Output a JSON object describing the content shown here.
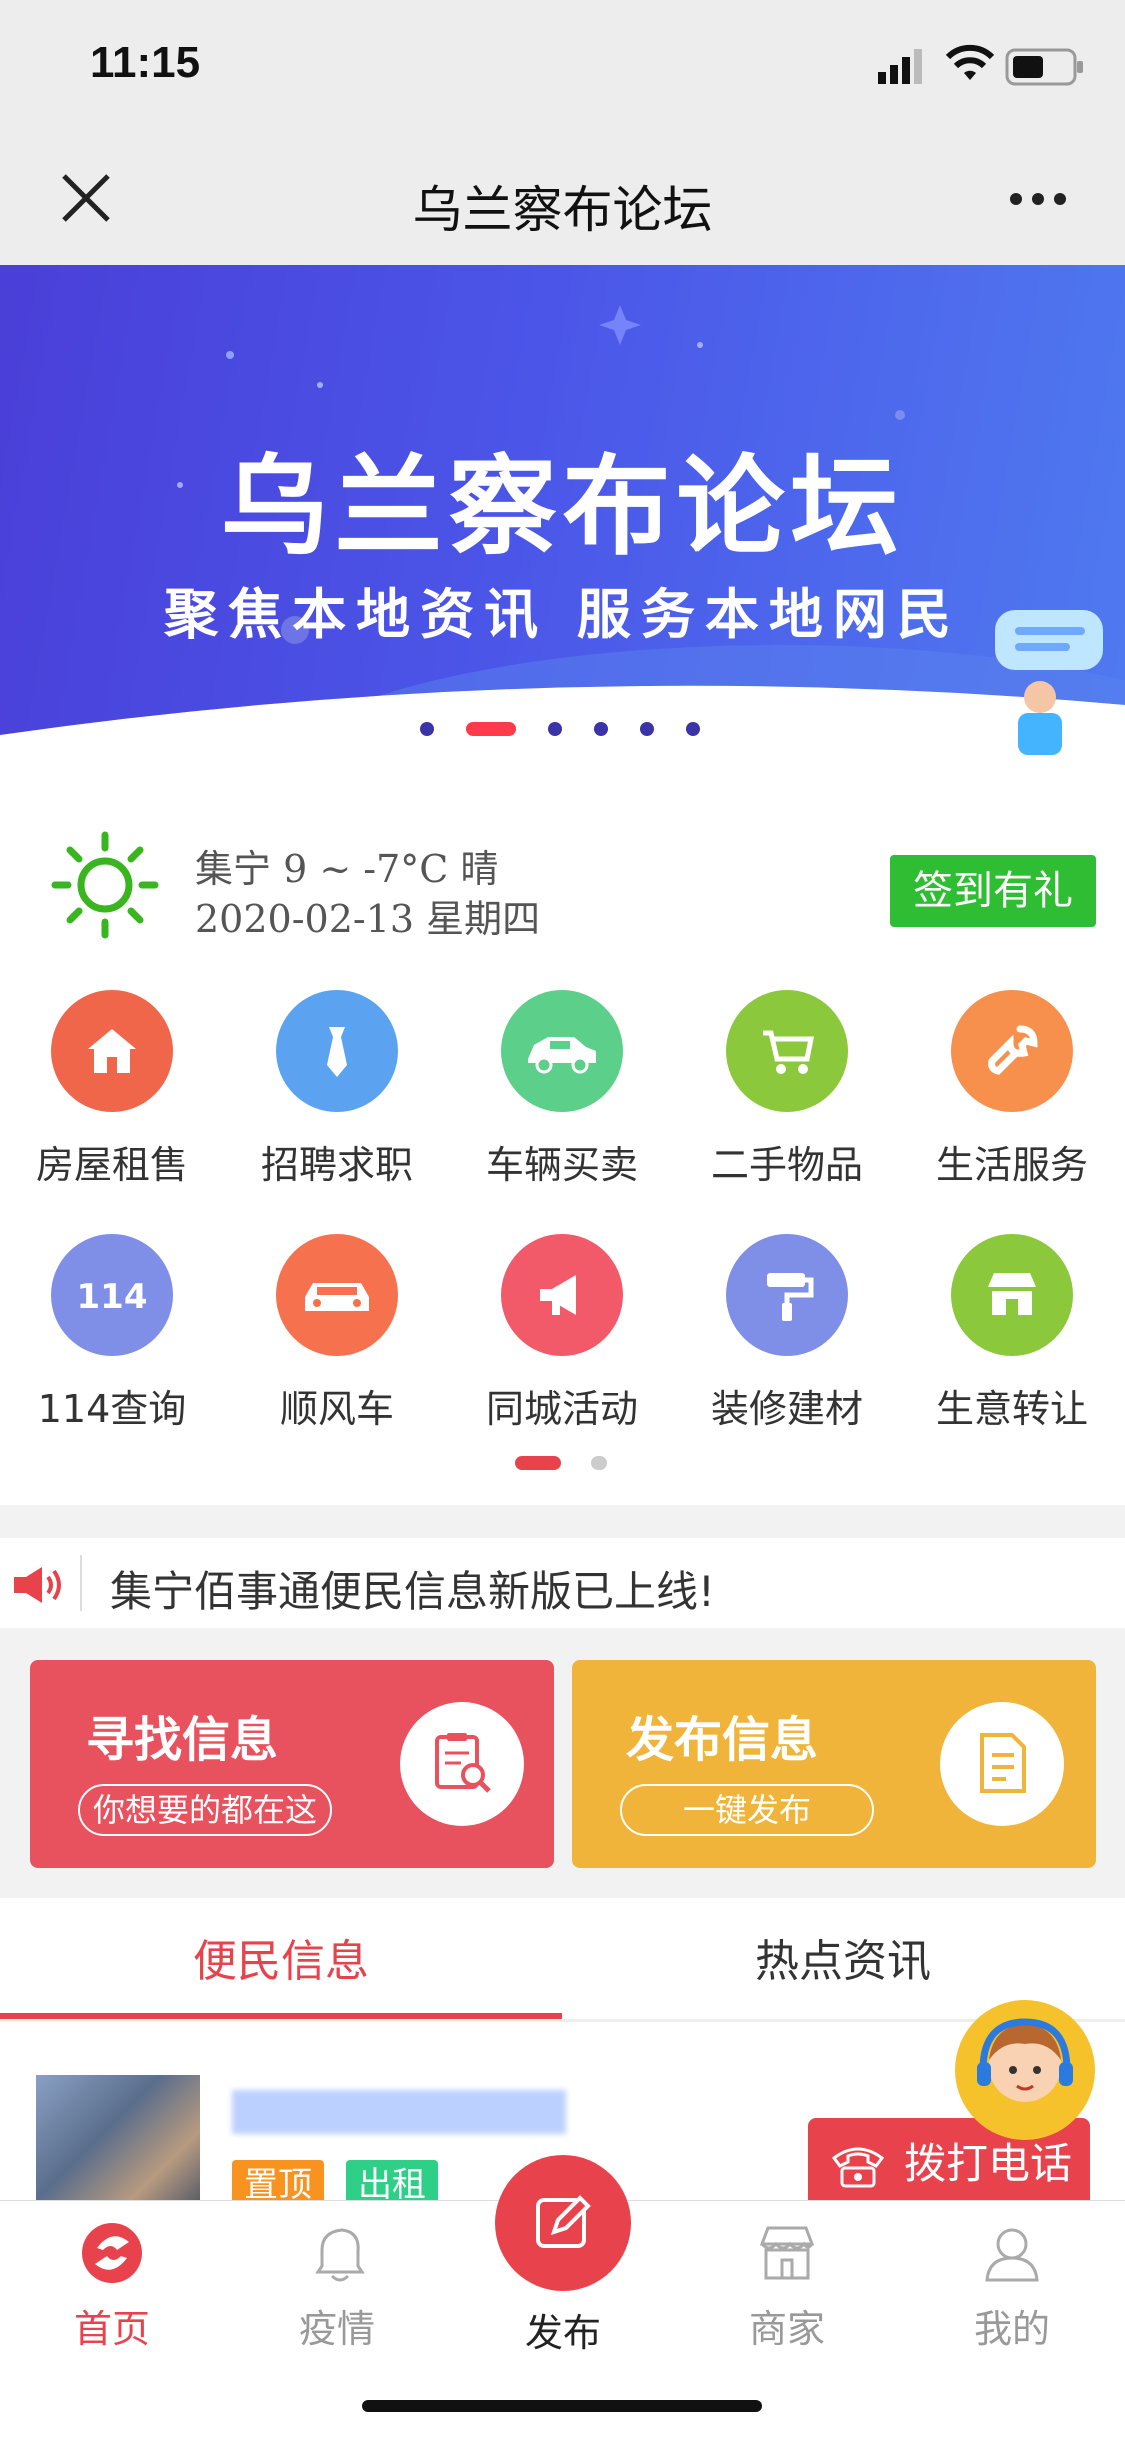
{
  "status": {
    "time": "11:15"
  },
  "nav": {
    "title": "乌兰察布论坛"
  },
  "banner": {
    "title": "乌兰察布论坛",
    "subtitle": "聚焦本地资讯 服务本地网民",
    "active_slide": 2,
    "slide_count": 6
  },
  "weather": {
    "line1": "集宁 9 ~ -7°C 晴",
    "line2": "2020-02-13 星期四",
    "signin_label": "签到有礼"
  },
  "grid": [
    {
      "label": "房屋租售",
      "icon": "house-icon",
      "color": "#f0664a"
    },
    {
      "label": "招聘求职",
      "icon": "tie-icon",
      "color": "#5ba3f0"
    },
    {
      "label": "车辆买卖",
      "icon": "car-icon",
      "color": "#5ccf8a"
    },
    {
      "label": "二手物品",
      "icon": "cart-icon",
      "color": "#8cc83c"
    },
    {
      "label": "生活服务",
      "icon": "wrench-icon",
      "color": "#f7904c"
    },
    {
      "label": "114查询",
      "icon": "114-icon",
      "color": "#7f8ee6"
    },
    {
      "label": "顺风车",
      "icon": "carpool-icon",
      "color": "#f6724e"
    },
    {
      "label": "同城活动",
      "icon": "megaphone-icon",
      "color": "#f25a6a"
    },
    {
      "label": "装修建材",
      "icon": "paint-roller-icon",
      "color": "#7f8ee6"
    },
    {
      "label": "生意转让",
      "icon": "shop-icon",
      "color": "#8cc83c"
    }
  ],
  "notice": {
    "text": "集宁佰事通便民信息新版已上线!"
  },
  "cards": {
    "find": {
      "title": "寻找信息",
      "pill": "你想要的都在这",
      "color": "#e8515e"
    },
    "publish": {
      "title": "发布信息",
      "pill": "一键发布",
      "color": "#f0b43a"
    }
  },
  "tabs": [
    {
      "label": "便民信息"
    },
    {
      "label": "热点资讯"
    }
  ],
  "listing": {
    "tags": [
      "置顶",
      "出租"
    ]
  },
  "call": {
    "label": "拨打电话"
  },
  "bottom_nav": [
    {
      "label": "首页"
    },
    {
      "label": "疫情"
    },
    {
      "label": "发布"
    },
    {
      "label": "商家"
    },
    {
      "label": "我的"
    }
  ],
  "colors": {
    "accent": "#e8434d",
    "green": "#2fbe33"
  }
}
